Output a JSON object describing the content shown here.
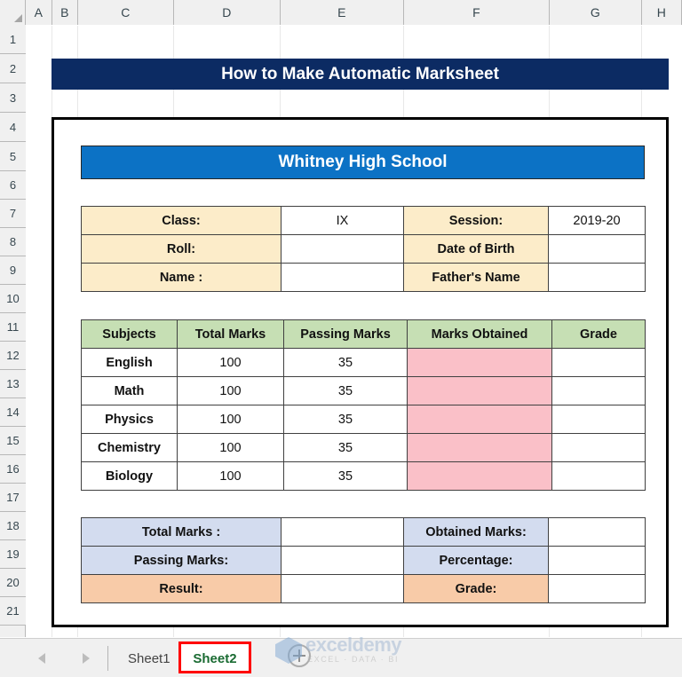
{
  "spreadsheet": {
    "column_headers": [
      "A",
      "B",
      "C",
      "D",
      "E",
      "F",
      "G",
      "H"
    ],
    "row_headers": [
      "1",
      "2",
      "3",
      "4",
      "5",
      "6",
      "7",
      "8",
      "9",
      "10",
      "11",
      "12",
      "13",
      "14",
      "15",
      "16",
      "17",
      "18",
      "19",
      "20",
      "21"
    ]
  },
  "title_banner": {
    "text": "How to Make Automatic Marksheet",
    "background": "#0c2b63",
    "color": "#ffffff"
  },
  "school_banner": {
    "text": "Whitney High School",
    "background": "#0c72c5",
    "color": "#ffffff"
  },
  "info": {
    "rows": [
      {
        "label_left": "Class:",
        "value_left": "IX",
        "label_right": "Session:",
        "value_right": "2019-20"
      },
      {
        "label_left": "Roll:",
        "value_left": "",
        "label_right": "Date of Birth",
        "value_right": ""
      },
      {
        "label_left": "Name :",
        "value_left": "",
        "label_right": "Father's Name",
        "value_right": ""
      }
    ],
    "label_background": "#fcecc9"
  },
  "marks_table": {
    "headers": [
      "Subjects",
      "Total Marks",
      "Passing Marks",
      "Marks Obtained",
      "Grade"
    ],
    "header_background": "#c6dfb4",
    "input_background": "#fac0c8",
    "rows": [
      {
        "subject": "English",
        "total": "100",
        "passing": "35",
        "obtained": "",
        "grade": ""
      },
      {
        "subject": "Math",
        "total": "100",
        "passing": "35",
        "obtained": "",
        "grade": ""
      },
      {
        "subject": "Physics",
        "total": "100",
        "passing": "35",
        "obtained": "",
        "grade": ""
      },
      {
        "subject": "Chemistry",
        "total": "100",
        "passing": "35",
        "obtained": "",
        "grade": ""
      },
      {
        "subject": "Biology",
        "total": "100",
        "passing": "35",
        "obtained": "",
        "grade": ""
      }
    ]
  },
  "summary": {
    "rows": [
      {
        "label_left": "Total Marks :",
        "value_left": "",
        "label_right": "Obtained Marks:",
        "value_right": ""
      },
      {
        "label_left": "Passing Marks:",
        "value_left": "",
        "label_right": "Percentage:",
        "value_right": ""
      },
      {
        "label_left": "Result:",
        "value_left": "",
        "label_right": "Grade:",
        "value_right": ""
      }
    ],
    "background_normal": "#d3dcef",
    "background_result": "#f8cba8"
  },
  "sheet_bar": {
    "tabs": [
      {
        "label": "Sheet1",
        "active": false
      },
      {
        "label": "Sheet2",
        "active": true
      }
    ],
    "highlight_color": "#ff0000"
  },
  "watermark": {
    "name": "exceldemy",
    "tagline": "EXCEL · DATA · BI"
  }
}
